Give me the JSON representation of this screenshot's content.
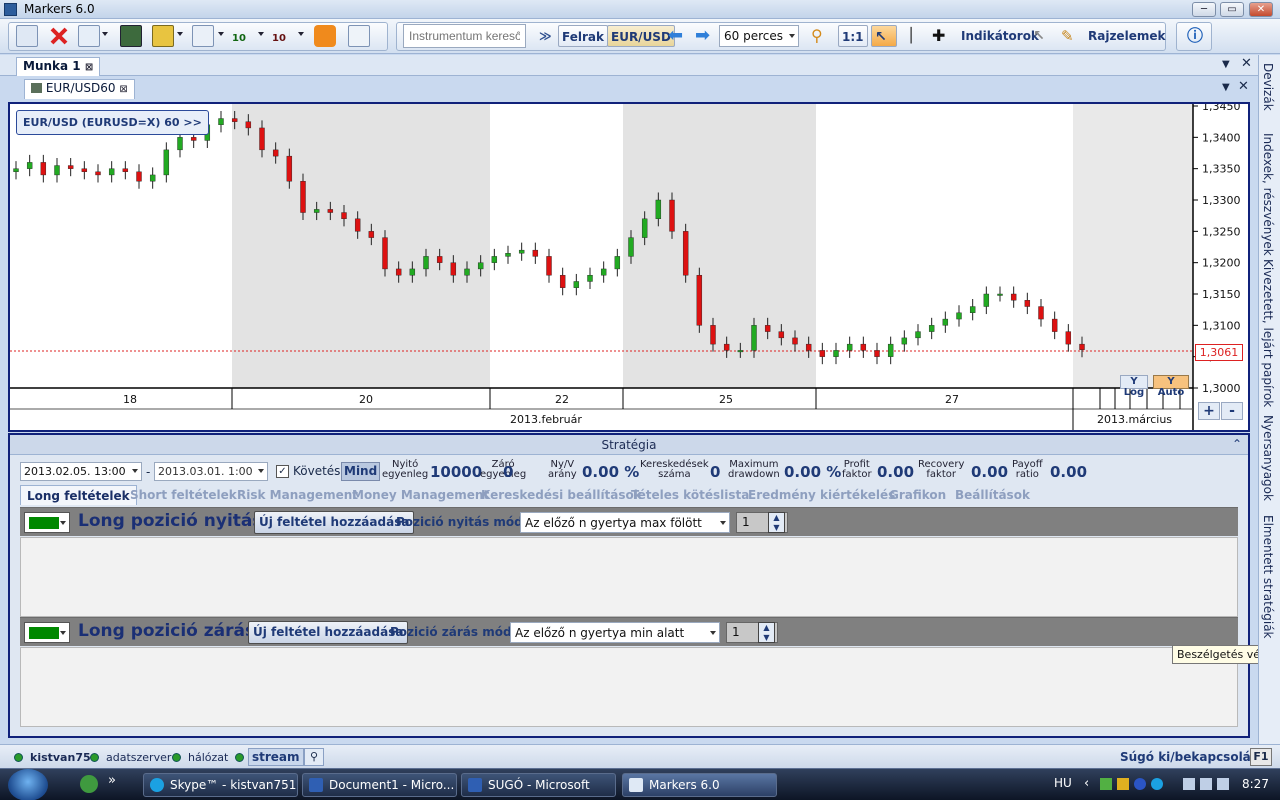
{
  "window": {
    "title": "Markers 6.0",
    "min": "─",
    "max": "▭",
    "close": "✕"
  },
  "toolbar": {
    "search_placeholder": "Instrumentum kereső",
    "felrak": "Felrak",
    "instrument": "EUR/USD",
    "timeframe": "60 perces",
    "ratio": "1:1",
    "indicators": "Indikátorok",
    "drawings": "Rajzelemek",
    "count_10a": "10",
    "count_10b": "10"
  },
  "tabs": {
    "munka": "Munka 1",
    "chart": "EUR/USD60"
  },
  "chart": {
    "legend": "EUR/USD (EURUSD=X) 60  >>",
    "price_label": "1,3061",
    "ylog": "Y Log",
    "yauto": "Y Auto",
    "zoom_in": "+",
    "zoom_out": "-",
    "y_ticks": [
      "1,3450",
      "1,3400",
      "1,3350",
      "1,3300",
      "1,3250",
      "1,3200",
      "1,3150",
      "1,3100",
      "1,3050",
      "1,3000"
    ],
    "x_days": [
      "18",
      "20",
      "22",
      "25",
      "27"
    ],
    "months": [
      "2013.február",
      "2013.március"
    ]
  },
  "chart_data": {
    "type": "candlestick",
    "title": "EUR/USD (EURUSD=X) 60",
    "y_range": [
      1.3,
      1.345
    ],
    "current_price": 1.3061,
    "x_labels": [
      "18",
      "20",
      "22",
      "25",
      "27"
    ],
    "months": [
      "2013.február",
      "2013.március"
    ],
    "close_series": [
      1.335,
      1.336,
      1.334,
      1.3355,
      1.335,
      1.3345,
      1.334,
      1.335,
      1.3345,
      1.333,
      1.334,
      1.338,
      1.34,
      1.3395,
      1.342,
      1.343,
      1.3425,
      1.3415,
      1.338,
      1.337,
      1.333,
      1.328,
      1.3285,
      1.328,
      1.327,
      1.325,
      1.324,
      1.319,
      1.318,
      1.319,
      1.321,
      1.32,
      1.318,
      1.319,
      1.32,
      1.321,
      1.3215,
      1.322,
      1.321,
      1.318,
      1.316,
      1.317,
      1.318,
      1.319,
      1.321,
      1.324,
      1.327,
      1.33,
      1.325,
      1.318,
      1.31,
      1.307,
      1.306,
      1.306,
      1.31,
      1.309,
      1.308,
      1.307,
      1.306,
      1.305,
      1.306,
      1.307,
      1.306,
      1.305,
      1.307,
      1.308,
      1.309,
      1.31,
      1.311,
      1.312,
      1.313,
      1.315,
      1.315,
      1.314,
      1.313,
      1.311,
      1.309,
      1.307,
      1.3061
    ]
  },
  "strategy": {
    "header": "Stratégia",
    "date_from": "2013.02.05. 13:00",
    "date_to": "2013.03.01. 1:00",
    "dash": "-",
    "follow": "Követés",
    "mind": "Mind",
    "stats": [
      {
        "label1": "Nyitó",
        "label2": "egyenleg",
        "value": "10000"
      },
      {
        "label1": "Záró",
        "label2": "egyenleg",
        "value": "0"
      },
      {
        "label1": "Ny/V",
        "label2": "arány",
        "value": "0.00 %"
      },
      {
        "label1": "Kereskedések",
        "label2": "száma",
        "value": "0"
      },
      {
        "label1": "Maximum",
        "label2": "drawdown",
        "value": "0.00 %"
      },
      {
        "label1": "Profit",
        "label2": "faktor",
        "value": "0.00"
      },
      {
        "label1": "Recovery",
        "label2": "faktor",
        "value": "0.00"
      },
      {
        "label1": "Payoff",
        "label2": "ratio",
        "value": "0.00"
      }
    ],
    "tabs": [
      "Long feltételek",
      "Short feltételek",
      "Risk Management",
      "Money Management",
      "Kereskedési beállítások",
      "Tételes kötéslista",
      "Eredmény kiértékelés",
      "Grafikon",
      "Beállítások"
    ],
    "open": {
      "title": "Long pozició nyitás",
      "add": "Új feltétel hozzáadása",
      "mode_label": "Pozició nyitás módja:",
      "mode": "Az előző n gyertya max fölött",
      "n": "1"
    },
    "close": {
      "title": "Long pozició zárás",
      "add": "Új feltétel hozzáadása",
      "mode_label": "Pozició zárás módja:",
      "mode": "Az előző n gyertya min alatt",
      "n": "1"
    }
  },
  "sidepanel": [
    "Devizák",
    "Indexek, részvények",
    "Kivezetett, lejárt papírok",
    "Nyersanyagok",
    "Elmentett stratégiák"
  ],
  "tooltip": "Beszélgetés vége",
  "status": {
    "user": "kistvan75",
    "server": "adatszerver",
    "network": "hálózat",
    "stream": "stream",
    "help": "Súgó ki/bekapcsolása:",
    "key": "F1"
  },
  "taskbar": {
    "items": [
      "Skype™ - kistvan751",
      "Document1 - Micro...",
      "SUGÓ - Microsoft W...",
      "Markers 6.0"
    ],
    "lang": "HU",
    "time": "8:27",
    "chevron": "»",
    "arrow": "‹"
  }
}
